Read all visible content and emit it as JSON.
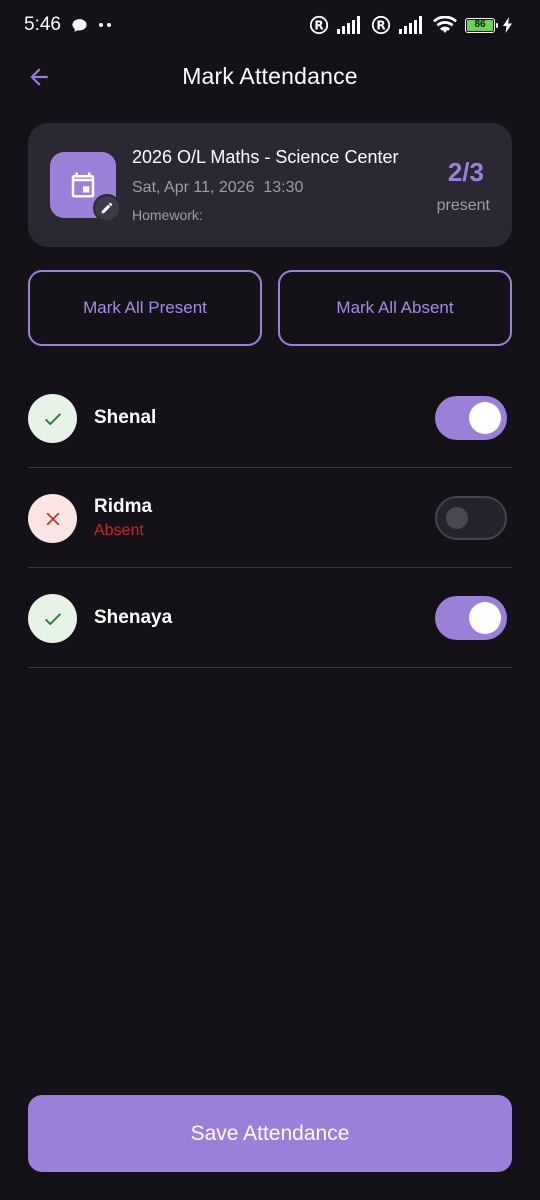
{
  "status_bar": {
    "time": "5:46",
    "battery": "86"
  },
  "header": {
    "title": "Mark Attendance"
  },
  "class_card": {
    "title": "2026 O/L Maths - Science Center",
    "date": "Sat, Apr 11, 2026  13:30",
    "homework": "Homework:",
    "count": "2/3",
    "count_label": "present"
  },
  "actions": {
    "mark_all_present": "Mark All Present",
    "mark_all_absent": "Mark All Absent"
  },
  "students": [
    {
      "name": "Shenal",
      "present": true,
      "status_text": ""
    },
    {
      "name": "Ridma",
      "present": false,
      "status_text": "Absent"
    },
    {
      "name": "Shenaya",
      "present": true,
      "status_text": ""
    }
  ],
  "footer": {
    "save_label": "Save Attendance"
  },
  "colors": {
    "background": "#141218",
    "accent": "#9b7fd8",
    "card": "#2b2834",
    "present": "#2e7d32",
    "absent": "#c62828"
  }
}
